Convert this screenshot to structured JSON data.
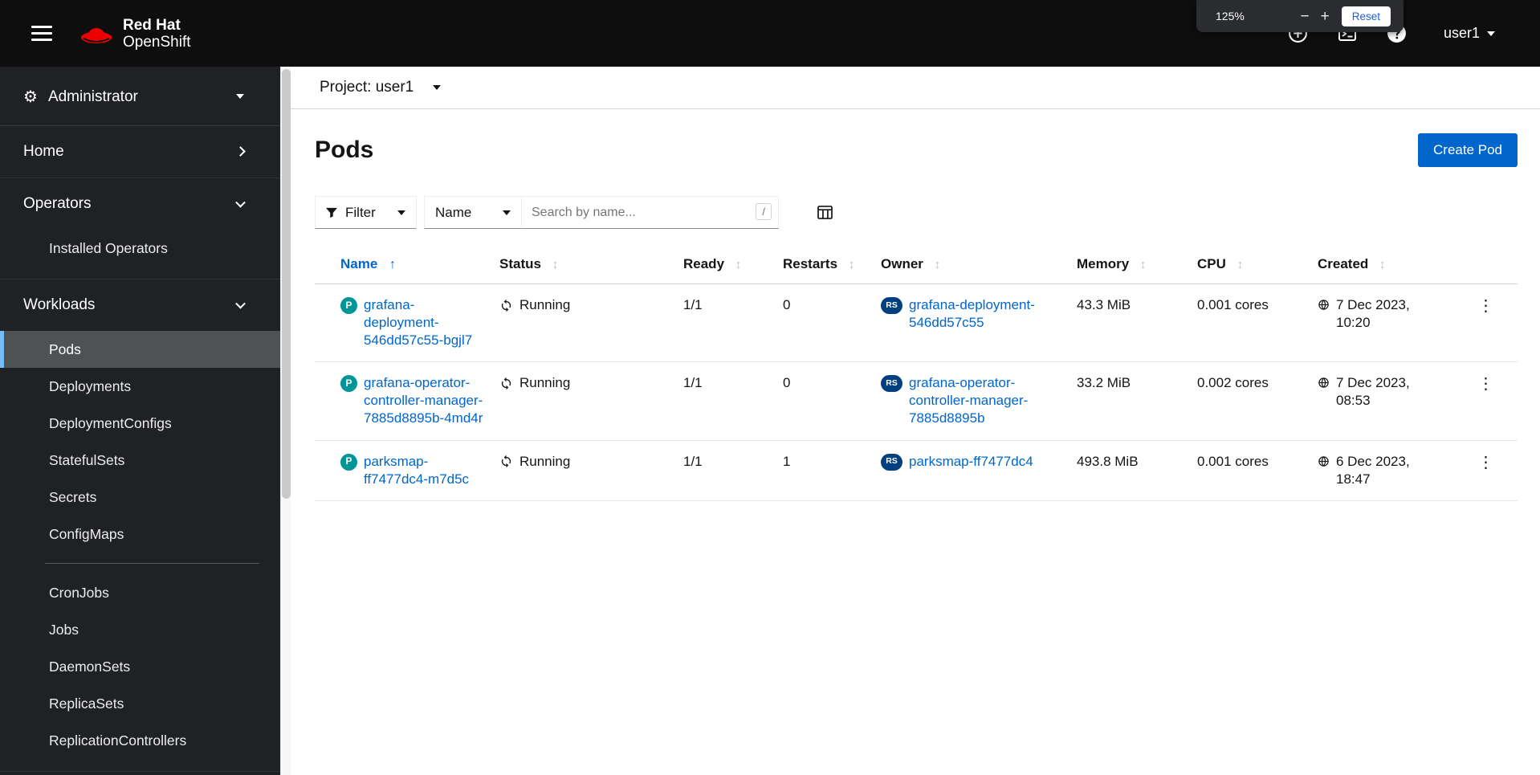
{
  "masthead": {
    "brand_line1": "Red Hat",
    "brand_line2": "OpenShift",
    "user_label": "user1"
  },
  "zoom_popup": {
    "level": "125%",
    "zoom_out": "−",
    "zoom_in": "+",
    "reset_label": "Reset"
  },
  "sidebar": {
    "perspective_label": "Administrator",
    "home_label": "Home",
    "operators_label": "Operators",
    "operators_items": [
      "Installed Operators"
    ],
    "workloads_label": "Workloads",
    "workloads_items": [
      "Pods",
      "Deployments",
      "DeploymentConfigs",
      "StatefulSets",
      "Secrets",
      "ConfigMaps",
      "CronJobs",
      "Jobs",
      "DaemonSets",
      "ReplicaSets",
      "ReplicationControllers"
    ],
    "active_item": "Pods"
  },
  "project_bar": {
    "label": "Project: user1"
  },
  "page_header": {
    "title": "Pods",
    "create_button_label": "Create Pod"
  },
  "toolbar": {
    "filter_label": "Filter",
    "attribute_label": "Name",
    "search_placeholder": "Search by name...",
    "shortcut_key": "/"
  },
  "table": {
    "columns": [
      "Name",
      "Status",
      "Ready",
      "Restarts",
      "Owner",
      "Memory",
      "CPU",
      "Created"
    ],
    "sorted_by": "Name",
    "sort_direction": "ascending",
    "rows": [
      {
        "badge": "P",
        "name": "grafana-deployment-546dd57c55-bgjl7",
        "status": "Running",
        "ready": "1/1",
        "restarts": "0",
        "owner_badge": "RS",
        "owner": "grafana-deployment-546dd57c55",
        "memory": "43.3 MiB",
        "cpu": "0.001 cores",
        "created": "7 Dec 2023, 10:20"
      },
      {
        "badge": "P",
        "name": "grafana-operator-controller-manager-7885d8895b-4md4r",
        "status": "Running",
        "ready": "1/1",
        "restarts": "0",
        "owner_badge": "RS",
        "owner": "grafana-operator-controller-manager-7885d8895b",
        "memory": "33.2 MiB",
        "cpu": "0.002 cores",
        "created": "7 Dec 2023, 08:53"
      },
      {
        "badge": "P",
        "name": "parksmap-ff7477dc4-m7d5c",
        "status": "Running",
        "ready": "1/1",
        "restarts": "1",
        "owner_badge": "RS",
        "owner": "parksmap-ff7477dc4",
        "memory": "493.8 MiB",
        "cpu": "0.001 cores",
        "created": "6 Dec 2023, 18:47"
      }
    ]
  },
  "glyphs": {
    "kebab": "⋮",
    "sort_inactive": "↕",
    "sort_asc": "↑",
    "gear": "⚙"
  },
  "colors": {
    "accent": "#0066cc",
    "brand_red": "#ee0000",
    "pod_badge": "#009596",
    "replicaset_badge": "#004080",
    "masthead_bg": "#0e0e0e",
    "sidebar_bg": "#1f2125",
    "active_nav_bg": "#4f5255",
    "active_nav_border": "#73bcf7",
    "running_icon": "#151515"
  }
}
